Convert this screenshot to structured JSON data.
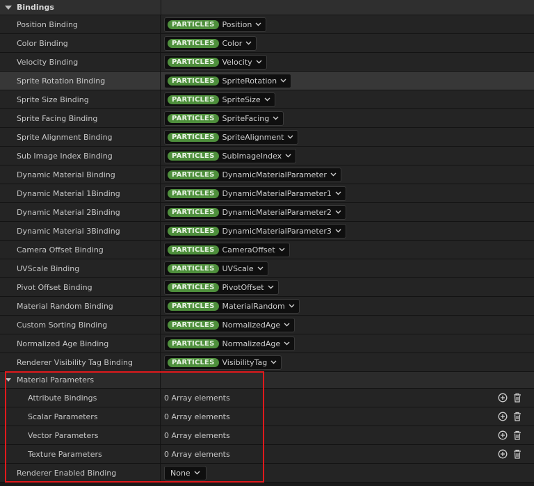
{
  "section": {
    "title": "Bindings"
  },
  "bindings": [
    {
      "label": "Position Binding",
      "source": "PARTICLES",
      "value": "Position"
    },
    {
      "label": "Color Binding",
      "source": "PARTICLES",
      "value": "Color"
    },
    {
      "label": "Velocity Binding",
      "source": "PARTICLES",
      "value": "Velocity"
    },
    {
      "label": "Sprite Rotation Binding",
      "source": "PARTICLES",
      "value": "SpriteRotation"
    },
    {
      "label": "Sprite Size Binding",
      "source": "PARTICLES",
      "value": "SpriteSize"
    },
    {
      "label": "Sprite Facing Binding",
      "source": "PARTICLES",
      "value": "SpriteFacing"
    },
    {
      "label": "Sprite Alignment Binding",
      "source": "PARTICLES",
      "value": "SpriteAlignment"
    },
    {
      "label": "Sub Image Index Binding",
      "source": "PARTICLES",
      "value": "SubImageIndex"
    },
    {
      "label": "Dynamic Material Binding",
      "source": "PARTICLES",
      "value": "DynamicMaterialParameter"
    },
    {
      "label": "Dynamic Material 1Binding",
      "source": "PARTICLES",
      "value": "DynamicMaterialParameter1"
    },
    {
      "label": "Dynamic Material 2Binding",
      "source": "PARTICLES",
      "value": "DynamicMaterialParameter2"
    },
    {
      "label": "Dynamic Material 3Binding",
      "source": "PARTICLES",
      "value": "DynamicMaterialParameter3"
    },
    {
      "label": "Camera Offset Binding",
      "source": "PARTICLES",
      "value": "CameraOffset"
    },
    {
      "label": "UVScale Binding",
      "source": "PARTICLES",
      "value": "UVScale"
    },
    {
      "label": "Pivot Offset Binding",
      "source": "PARTICLES",
      "value": "PivotOffset"
    },
    {
      "label": "Material Random Binding",
      "source": "PARTICLES",
      "value": "MaterialRandom"
    },
    {
      "label": "Custom Sorting Binding",
      "source": "PARTICLES",
      "value": "NormalizedAge"
    },
    {
      "label": "Normalized Age Binding",
      "source": "PARTICLES",
      "value": "NormalizedAge"
    },
    {
      "label": "Renderer Visibility Tag Binding",
      "source": "PARTICLES",
      "value": "VisibilityTag"
    }
  ],
  "material_parameters": {
    "label": "Material Parameters",
    "items": [
      {
        "label": "Attribute Bindings",
        "value": "0 Array elements"
      },
      {
        "label": "Scalar Parameters",
        "value": "0 Array elements"
      },
      {
        "label": "Vector Parameters",
        "value": "0 Array elements"
      },
      {
        "label": "Texture Parameters",
        "value": "0 Array elements"
      }
    ]
  },
  "renderer_enabled": {
    "label": "Renderer Enabled Binding",
    "value": "None"
  },
  "highlighted_row_index": 3,
  "colors": {
    "pill": "#4e8f3c",
    "highlight_box": "#e0191c",
    "background": "#1a1a1a"
  },
  "icons": {
    "add": "plus-circle-icon",
    "delete": "trash-icon",
    "dropdown": "chevron-down-icon",
    "expand": "triangle-down-icon"
  }
}
